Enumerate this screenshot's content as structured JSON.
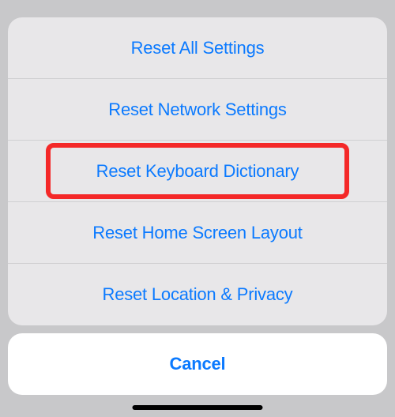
{
  "sheet": {
    "items": [
      {
        "label": "Reset All Settings"
      },
      {
        "label": "Reset Network Settings"
      },
      {
        "label": "Reset Keyboard Dictionary"
      },
      {
        "label": "Reset Home Screen Layout"
      },
      {
        "label": "Reset Location & Privacy"
      }
    ]
  },
  "cancel": {
    "label": "Cancel"
  },
  "highlight_index": 2
}
